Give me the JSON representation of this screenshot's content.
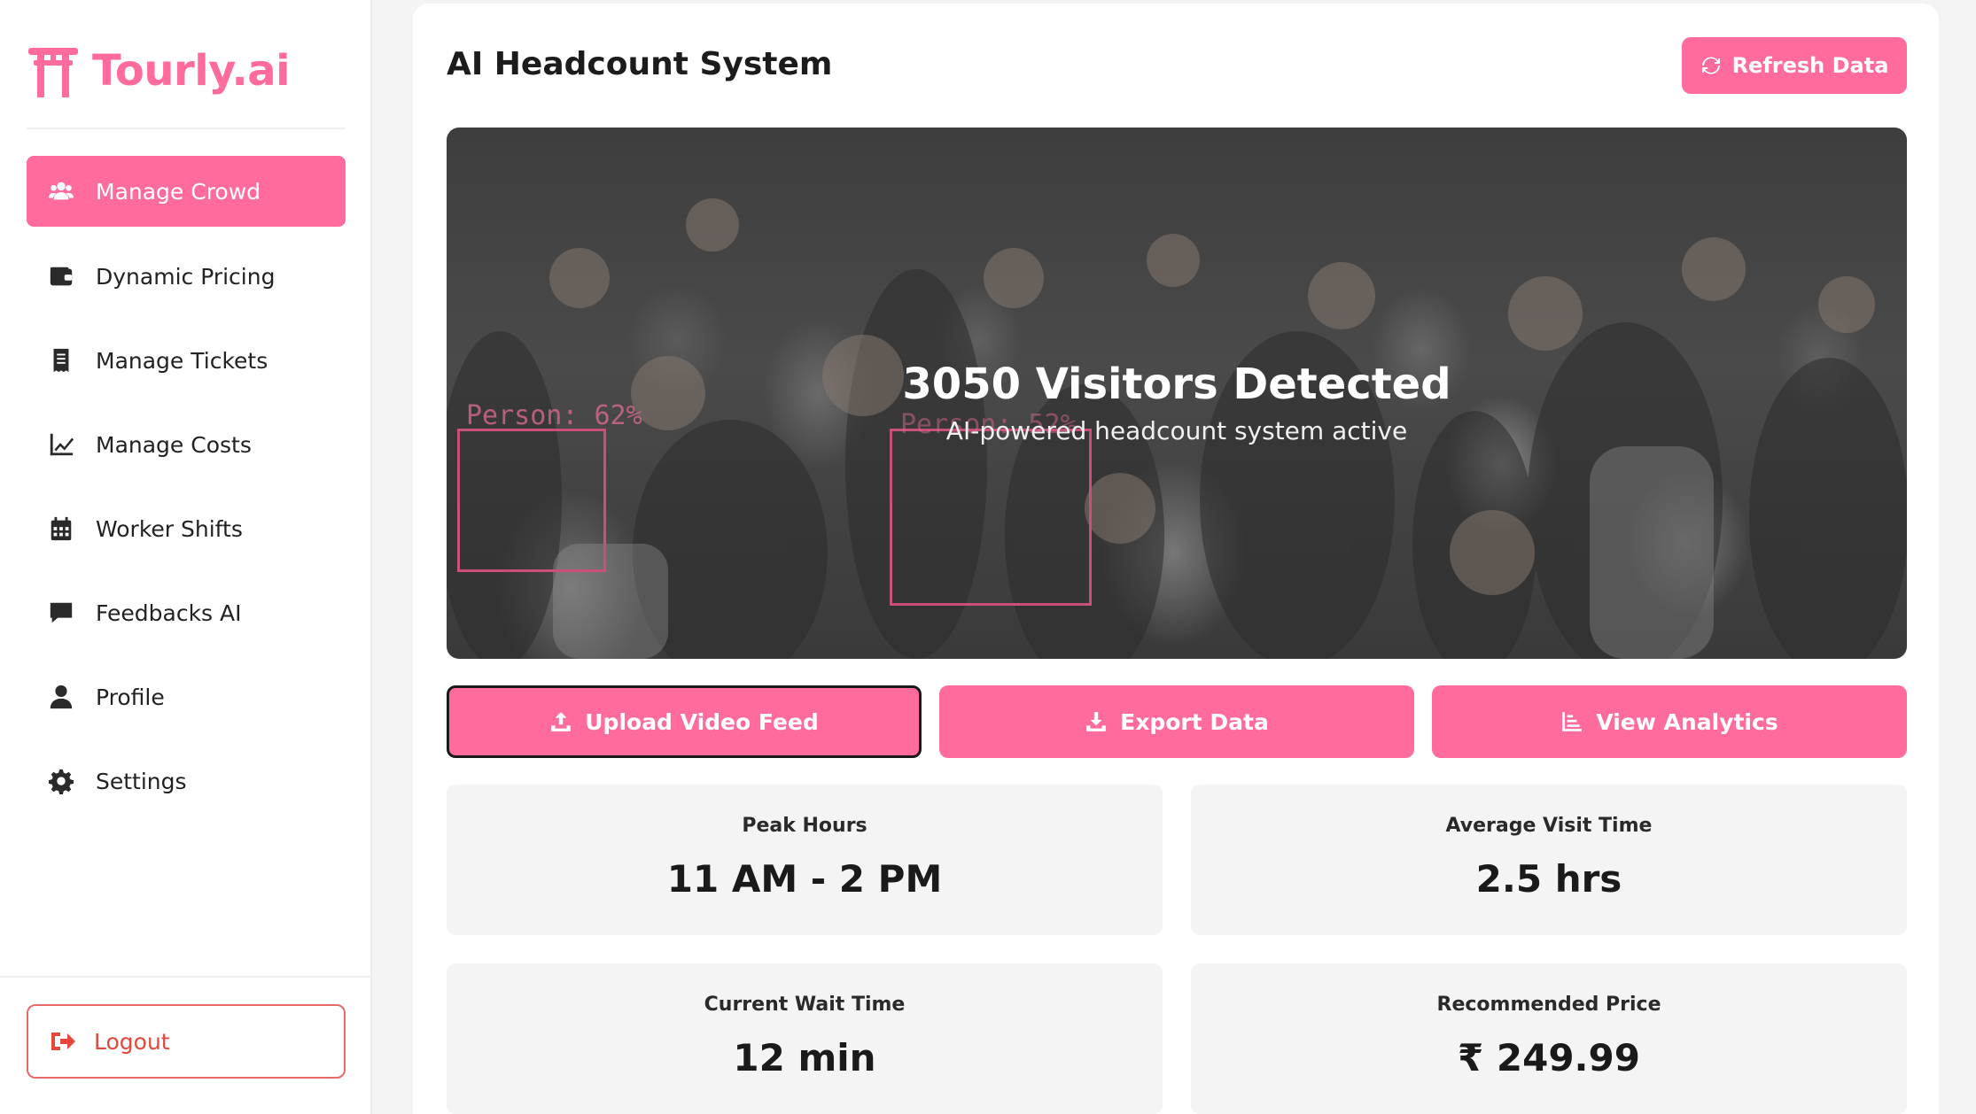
{
  "brand": {
    "name": "Tourly.ai",
    "accent": "#ff6b9d"
  },
  "sidebar": {
    "items": [
      {
        "label": "Manage Crowd",
        "icon": "users-icon",
        "active": true
      },
      {
        "label": "Dynamic Pricing",
        "icon": "wallet-icon",
        "active": false
      },
      {
        "label": "Manage Tickets",
        "icon": "receipt-icon",
        "active": false
      },
      {
        "label": "Manage Costs",
        "icon": "line-chart-icon",
        "active": false
      },
      {
        "label": "Worker Shifts",
        "icon": "calendar-icon",
        "active": false
      },
      {
        "label": "Feedbacks AI",
        "icon": "comment-icon",
        "active": false
      },
      {
        "label": "Profile",
        "icon": "user-icon",
        "active": false
      },
      {
        "label": "Settings",
        "icon": "gear-icon",
        "active": false
      }
    ],
    "logout_label": "Logout"
  },
  "header": {
    "title": "AI Headcount System",
    "refresh_label": "Refresh Data"
  },
  "video": {
    "title": "3050 Visitors Detected",
    "subtitle": "AI-powered headcount system active",
    "detections": [
      {
        "label": "Person: 62%"
      },
      {
        "label": "Person: 52%"
      }
    ]
  },
  "actions": {
    "upload_label": "Upload Video Feed",
    "export_label": "Export Data",
    "analytics_label": "View Analytics"
  },
  "stats": [
    {
      "label": "Peak Hours",
      "value": "11 AM - 2 PM"
    },
    {
      "label": "Average Visit Time",
      "value": "2.5 hrs"
    },
    {
      "label": "Current Wait Time",
      "value": "12 min"
    },
    {
      "label": "Recommended Price",
      "value": "₹ 249.99"
    }
  ]
}
